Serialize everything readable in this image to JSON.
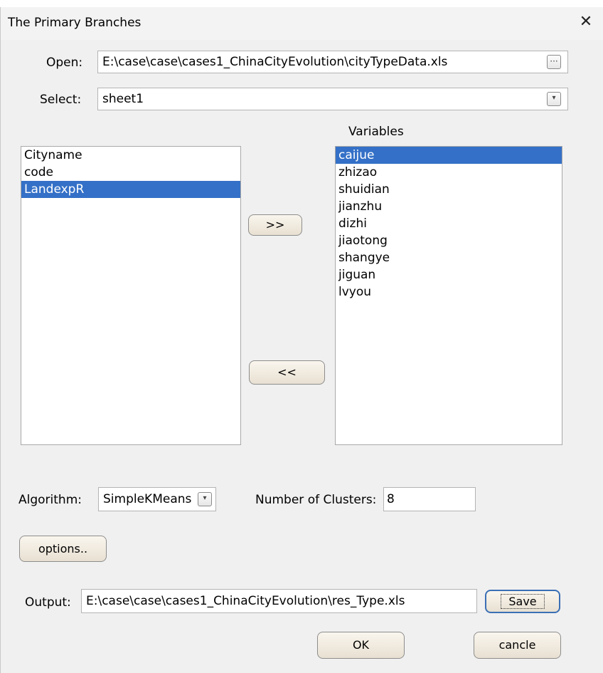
{
  "window": {
    "title": "The Primary Branches"
  },
  "open": {
    "label": "Open:",
    "value": "E:\\case\\case\\cases1_ChinaCityEvolution\\cityTypeData.xls",
    "browse_glyph": "···"
  },
  "select": {
    "label": "Select:",
    "value": "sheet1"
  },
  "variables_header": "Variables",
  "left_list": [
    {
      "label": "Cityname",
      "selected": false
    },
    {
      "label": "code",
      "selected": false
    },
    {
      "label": "LandexpR",
      "selected": true
    }
  ],
  "right_list": [
    {
      "label": "caijue",
      "selected": true
    },
    {
      "label": "zhizao",
      "selected": false
    },
    {
      "label": "shuidian",
      "selected": false
    },
    {
      "label": "jianzhu",
      "selected": false
    },
    {
      "label": "dizhi",
      "selected": false
    },
    {
      "label": "jiaotong",
      "selected": false
    },
    {
      "label": "shangye",
      "selected": false
    },
    {
      "label": "jiguan",
      "selected": false
    },
    {
      "label": "lvyou",
      "selected": false
    }
  ],
  "buttons": {
    "add": ">>",
    "remove": "<<",
    "options": "options..",
    "save": "Save",
    "ok": "OK",
    "cancel": "cancle"
  },
  "algorithm": {
    "label": "Algorithm:",
    "value": "SimpleKMeans"
  },
  "clusters": {
    "label": "Number of Clusters:",
    "value": "8"
  },
  "output": {
    "label": "Output:",
    "value": "E:\\case\\case\\cases1_ChinaCityEvolution\\res_Type.xls"
  },
  "colors": {
    "selection": "#3470c7",
    "dialog_bg": "#f0f0f0",
    "button_bg": "#efe8dc"
  }
}
